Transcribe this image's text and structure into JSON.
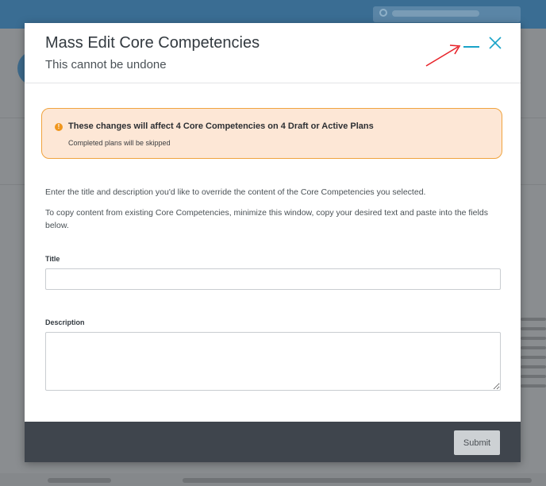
{
  "modal": {
    "title": "Mass Edit Core Competencies",
    "subtitle": "This cannot be undone",
    "minimize_icon": "minimize-icon",
    "close_icon": "close-icon"
  },
  "alert": {
    "icon": "warning-icon",
    "title": "These changes will affect 4 Core Competencies on 4 Draft or Active Plans",
    "text": "Completed plans will be skipped",
    "border_color": "#f0a33e",
    "background_color": "#fde7d6"
  },
  "instructions": [
    "Enter the title and description you'd like to override the content of the Core Competencies you selected.",
    "To copy content from existing Core Competencies, minimize this window, copy your desired text and paste into the fields below."
  ],
  "form": {
    "title_label": "Title",
    "title_value": "",
    "description_label": "Description",
    "description_value": ""
  },
  "footer": {
    "submit_label": "Submit"
  },
  "colors": {
    "accent": "#1aa3c8",
    "annotation_arrow": "#e8232a",
    "footer_background": "#3f454d"
  }
}
